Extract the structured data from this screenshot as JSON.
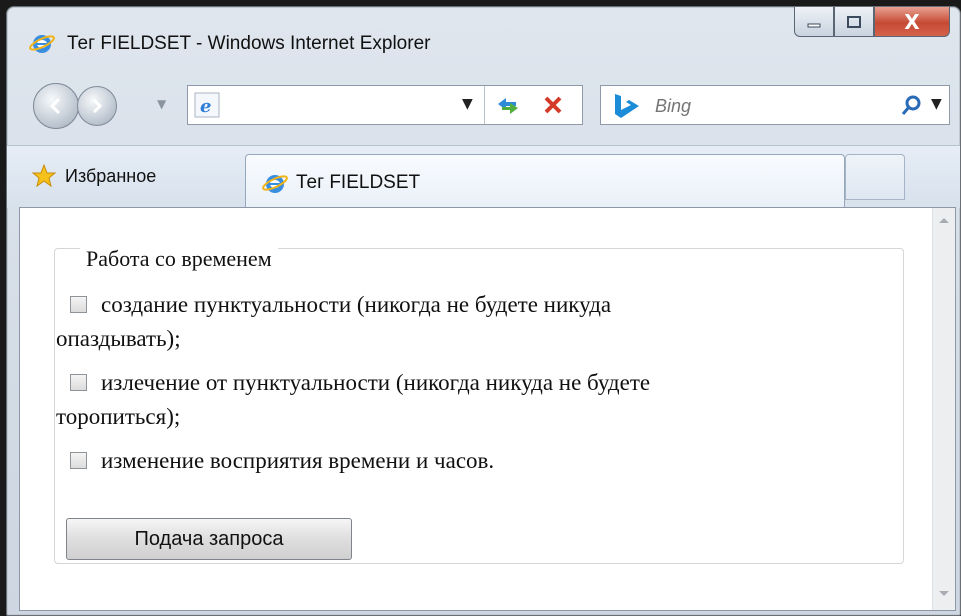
{
  "window": {
    "title": "Тег FIELDSET - Windows Internet Explorer",
    "close_label": "X"
  },
  "address": {
    "value": ""
  },
  "search": {
    "placeholder": "Bing"
  },
  "favorites": {
    "label": "Избранное"
  },
  "tab": {
    "label": "Тег FIELDSET"
  },
  "form": {
    "legend": "Работа со временем",
    "options": [
      {
        "line1": "создание пунктуальности (никогда не будете никуда",
        "line2": "опаздывать);"
      },
      {
        "line1": "излечение от пунктуальности (никогда никуда не будете",
        "line2": "торопиться);"
      },
      {
        "line1": "изменение восприятия времени и часов.",
        "line2": ""
      }
    ],
    "submit_label": "Подача запроса"
  }
}
